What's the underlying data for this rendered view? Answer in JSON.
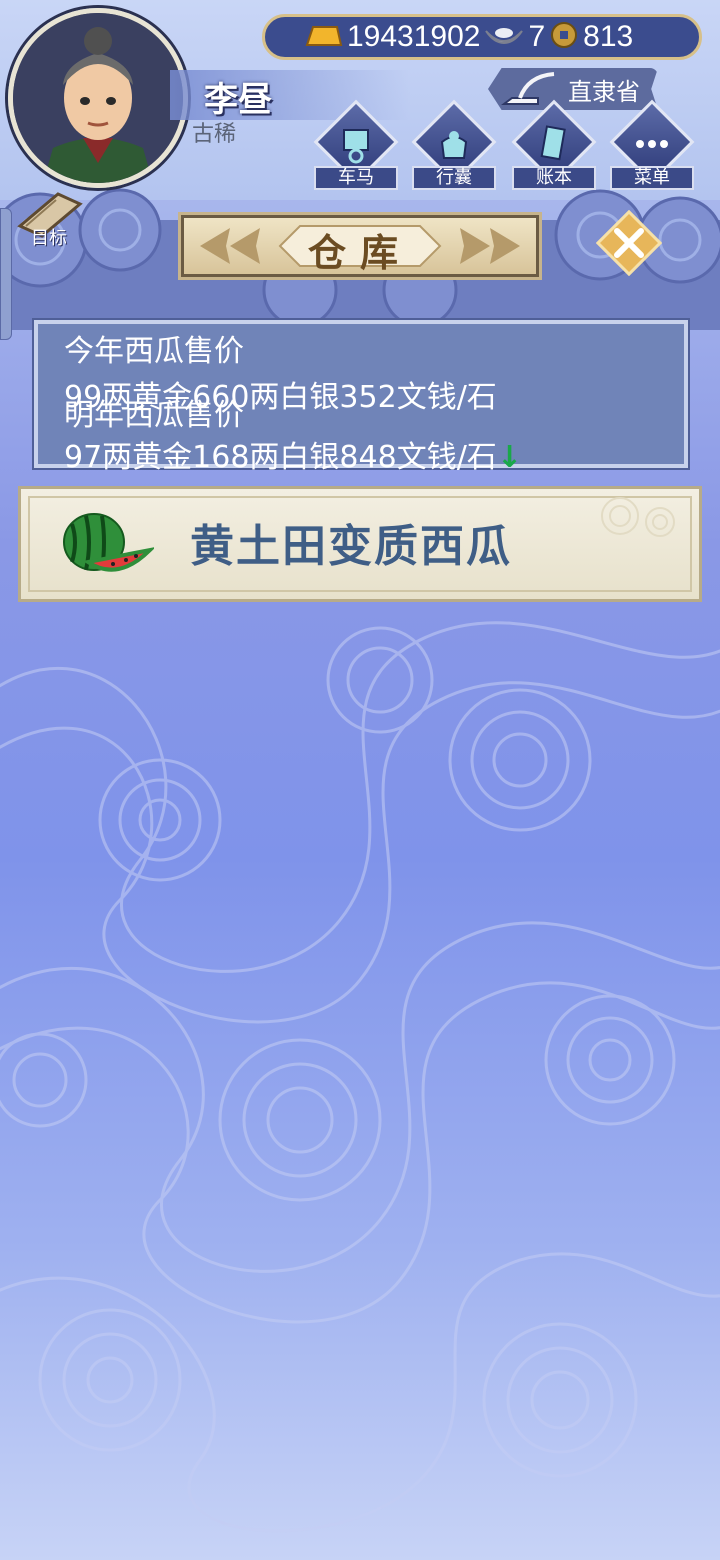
{
  "player": {
    "name": "李昼",
    "age_label": "古稀"
  },
  "currency": {
    "gold": "19431902",
    "silver": "7",
    "copper": "813"
  },
  "location": "直隶省",
  "menu": [
    {
      "label": "车马",
      "icon": "carriage-icon"
    },
    {
      "label": "行囊",
      "icon": "bundle-icon"
    },
    {
      "label": "账本",
      "icon": "ledger-icon"
    },
    {
      "label": "菜单",
      "icon": "more-icon"
    }
  ],
  "goal_label": "目标",
  "panel": {
    "title": "仓库"
  },
  "prices": {
    "this_year_label": "今年西瓜售价",
    "this_year_price": "99两黄金660两白银352文钱/石",
    "next_year_label": "明年西瓜售价",
    "next_year_price": "97两黄金168两白银848文钱/石",
    "trend_arrow": "↓",
    "trend_color": "#1aa84a"
  },
  "items": [
    {
      "name": "黄土田变质西瓜",
      "icon": "watermelon-icon"
    }
  ]
}
